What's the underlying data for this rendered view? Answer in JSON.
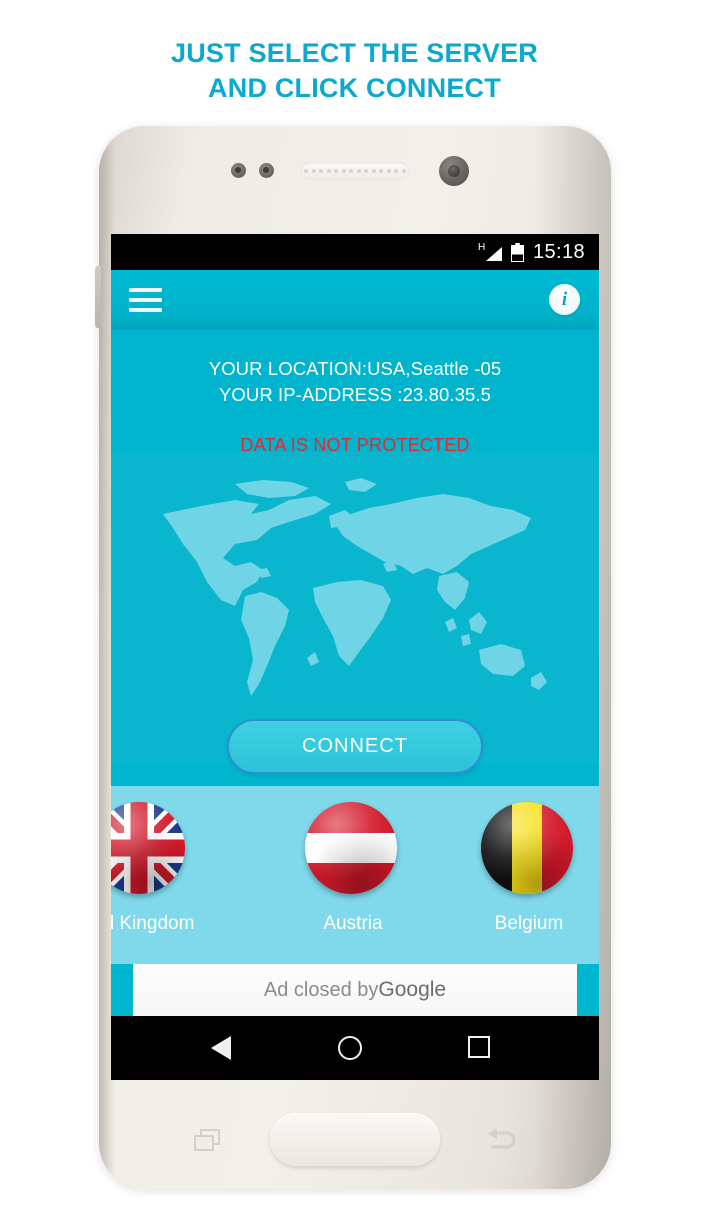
{
  "headline": {
    "line1": "JUST SELECT THE SERVER",
    "line2": "AND CLICK CONNECT",
    "color": "#0BA9CC"
  },
  "status_bar": {
    "network_label": "H",
    "network_icon": "signal-triangle-icon",
    "battery_icon": "battery-icon",
    "clock": "15:18"
  },
  "app_bar": {
    "menu_icon": "hamburger-menu-icon",
    "info_icon": "info-icon",
    "info_letter": "i",
    "background_color": "#00B2CA"
  },
  "info_block": {
    "location": "YOUR LOCATION:USA,Seattle -05",
    "ip_address": "YOUR IP-ADDRESS :23.80.35.5",
    "warning": "DATA IS NOT PROTECTED",
    "warning_color": "#E8272C"
  },
  "map": {
    "icon": "world-map-icon",
    "land_color": "#6FD4E6",
    "ocean_color": "#0AB6CD"
  },
  "connect": {
    "label": "CONNECT",
    "fill_color": "#34C9DD",
    "border_color": "#2D8FD4"
  },
  "server_panel": {
    "background_color": "#7FD9EA",
    "servers": [
      {
        "label": "ed Kingdom",
        "flag": "united-kingdom-flag-icon"
      },
      {
        "label": "Austria",
        "flag": "austria-flag-icon"
      },
      {
        "label": "Belgium",
        "flag": "belgium-flag-icon"
      }
    ]
  },
  "ad_banner": {
    "text": "Ad closed by ",
    "brand": "Google"
  },
  "nav_bar": {
    "back_icon": "back-triangle-icon",
    "home_icon": "home-circle-icon",
    "recent_icon": "recents-square-icon"
  },
  "hardware": {
    "recent_icon": "hw-recents-icon",
    "home_icon": "hw-home-button",
    "back_icon": "hw-back-icon"
  }
}
